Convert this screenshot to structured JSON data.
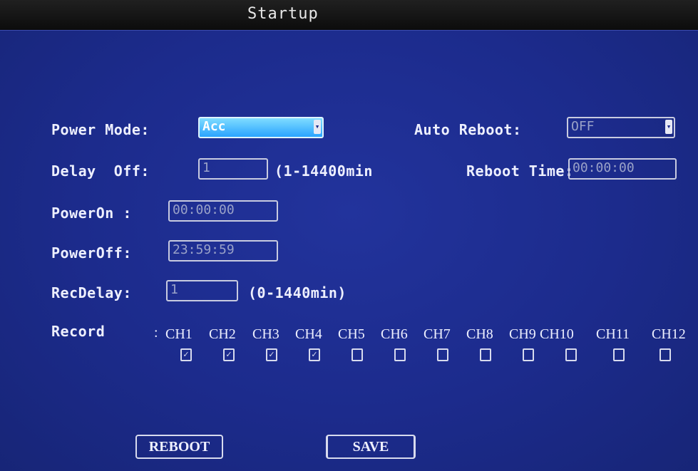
{
  "window": {
    "title": "Startup"
  },
  "power_mode": {
    "label": "Power Mode:",
    "value": "Acc"
  },
  "auto_reboot": {
    "label": "Auto Reboot:",
    "value": "OFF"
  },
  "delay_off": {
    "label": "Delay  Off:",
    "value": "1",
    "range": "(1-14400min"
  },
  "reboot_time": {
    "label": "Reboot Time:",
    "value": "00:00:00"
  },
  "power_on": {
    "label": "PowerOn :",
    "value": "00:00:00"
  },
  "power_off": {
    "label": "PowerOff:",
    "value": "23:59:59"
  },
  "rec_delay": {
    "label": "RecDelay:",
    "value": "1",
    "range": "(0-1440min)"
  },
  "record": {
    "label": "Record",
    "separator": ":",
    "channels": [
      {
        "name": "CH1",
        "checked": true
      },
      {
        "name": "CH2",
        "checked": true
      },
      {
        "name": "CH3",
        "checked": true
      },
      {
        "name": "CH4",
        "checked": true
      },
      {
        "name": "CH5",
        "checked": false
      },
      {
        "name": "CH6",
        "checked": false
      },
      {
        "name": "CH7",
        "checked": false
      },
      {
        "name": "CH8",
        "checked": false
      },
      {
        "name": "CH9",
        "checked": false
      },
      {
        "name": "CH10",
        "checked": false
      },
      {
        "name": "CH11",
        "checked": false
      },
      {
        "name": "CH12",
        "checked": false
      }
    ]
  },
  "buttons": {
    "reboot": "REBOOT",
    "save": "SAVE"
  },
  "icons": {
    "dropdown": "dropdown-arrow-icon",
    "check": "checkmark-icon"
  },
  "colors": {
    "background": "#1b2a8a",
    "highlight": "#2aa4ff",
    "titlebar": "#111111"
  }
}
